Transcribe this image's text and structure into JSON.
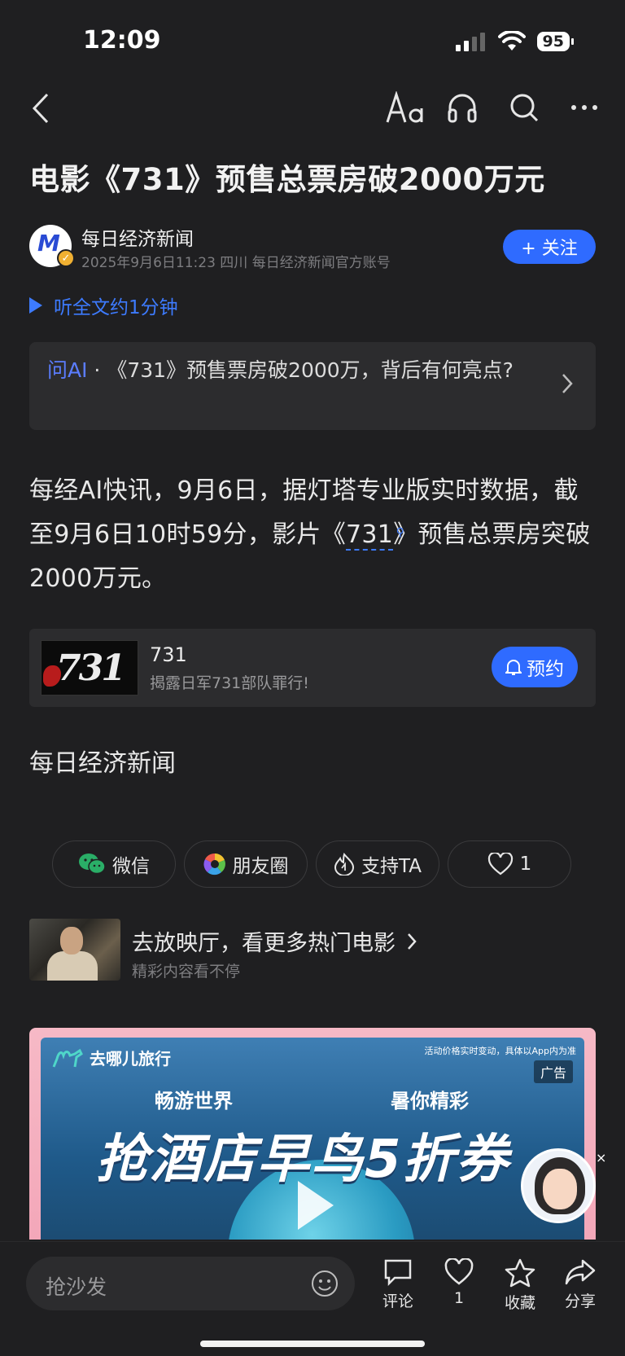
{
  "status": {
    "time": "12:09",
    "battery": "95"
  },
  "article": {
    "title": "电影《731》预售总票房破2000万元",
    "author": "每日经济新闻",
    "meta": "2025年9月6日11:23 四川 每日经济新闻官方账号",
    "follow_label": "+ 关注",
    "listen_label": "听全文约1分钟",
    "ai_prefix": "问AI",
    "ai_question": " · 《731》预售票房破2000万，背后有何亮点?",
    "body_part1": "每经AI快讯，9月6日，据灯塔专业版实时数据，截至9月6日10时59分，影片《",
    "body_link": "731",
    "body_part2": "》预售总票房突破2000万元。",
    "source": "每日经济新闻"
  },
  "movie_card": {
    "poster_text": "731",
    "name": "731",
    "subtitle": "揭露日军731部队罪行!",
    "reserve_label": "预约"
  },
  "share": {
    "wechat": "微信",
    "moments": "朋友圈",
    "support": "支持TA",
    "like_count": "1"
  },
  "recommend": {
    "title": "去放映厅，看更多热门电影",
    "subtitle": "精彩内容看不停"
  },
  "ad": {
    "brand": "去哪儿旅行",
    "fine_print": "活动价格实时变动，具体以App内为准",
    "tag": "广告",
    "line1": "畅游世界",
    "line2": "暑你精彩",
    "headline": "抢酒店早鸟5折券"
  },
  "bottom_bar": {
    "comment_placeholder": "抢沙发",
    "comment_label": "评论",
    "like_count": "1",
    "collect_label": "收藏",
    "share_label": "分享"
  },
  "colors": {
    "accent": "#2f6bff",
    "background": "#1f1f21"
  }
}
